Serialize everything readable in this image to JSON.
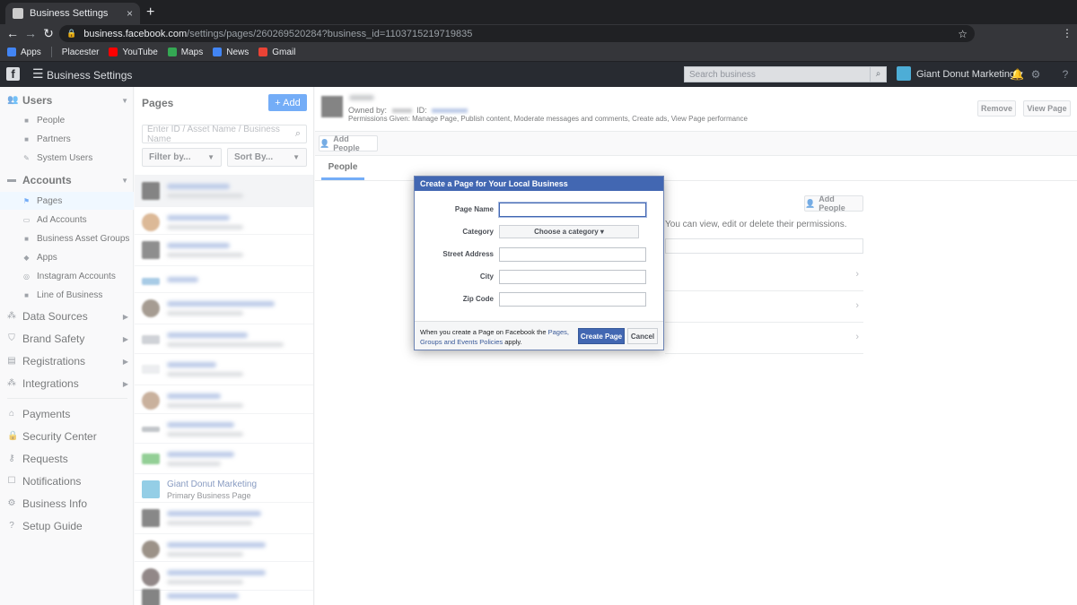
{
  "browser": {
    "tab_title": "Business Settings",
    "tab_close": "×",
    "new_tab": "+",
    "url_host": "business.facebook.com",
    "url_path": "/settings/pages/260269520284?business_id=1103715219719835",
    "bookmarks": [
      {
        "label": "Apps",
        "color": "#4285f4"
      },
      {
        "label": "Placester",
        "color": "#35363a"
      },
      {
        "label": "YouTube",
        "color": "#ff0000"
      },
      {
        "label": "Maps",
        "color": "#34a853"
      },
      {
        "label": "News",
        "color": "#4285f4"
      },
      {
        "label": "Gmail",
        "color": "#ea4335"
      }
    ]
  },
  "topbar": {
    "logo": "f",
    "title": "Business Settings",
    "search_placeholder": "Search business",
    "account_name": "Giant Donut Marketing ▾"
  },
  "sidebar": {
    "users": {
      "label": "Users",
      "items": [
        "People",
        "Partners",
        "System Users"
      ]
    },
    "accounts": {
      "label": "Accounts",
      "items": [
        "Pages",
        "Ad Accounts",
        "Business Asset Groups",
        "Apps",
        "Instagram Accounts",
        "Line of Business"
      ]
    },
    "sections": [
      "Data Sources",
      "Brand Safety",
      "Registrations",
      "Integrations"
    ],
    "bottom": [
      "Payments",
      "Security Center",
      "Requests",
      "Notifications",
      "Business Info",
      "Setup Guide"
    ]
  },
  "pages_panel": {
    "title": "Pages",
    "add_label": "+ Add",
    "search_placeholder": "Enter ID / Asset Name / Business Name",
    "filter_label": "Filter by...",
    "sort_label": "Sort By...",
    "visible_page": {
      "name": "Giant Donut Marketing",
      "subtitle": "Primary Business Page"
    }
  },
  "main": {
    "owned_by": "Owned by:",
    "id_label": "ID:",
    "permissions": "Permissions Given: Manage Page, Publish content, Moderate messages and comments, Create ads, View Page performance",
    "remove_label": "Remove",
    "view_page_label": "View Page",
    "add_people_label": "Add People",
    "tab_people": "People",
    "can_view_text": "You can view, edit or delete their permissions."
  },
  "dialog": {
    "title": "Create a Page for Your Local Business",
    "fields": {
      "page_name": "Page Name",
      "category": "Category",
      "street": "Street Address",
      "city": "City",
      "zip": "Zip Code"
    },
    "category_select": "Choose a category ▾",
    "footnote_pre": "When you create a Page on Facebook the ",
    "footnote_link": "Pages, Groups and Events Policies",
    "footnote_post": " apply.",
    "create_label": "Create Page",
    "cancel_label": "Cancel"
  },
  "colors": {
    "fb_blue": "#1877f2",
    "dialog_header": "#4267b2",
    "link": "#385898"
  }
}
